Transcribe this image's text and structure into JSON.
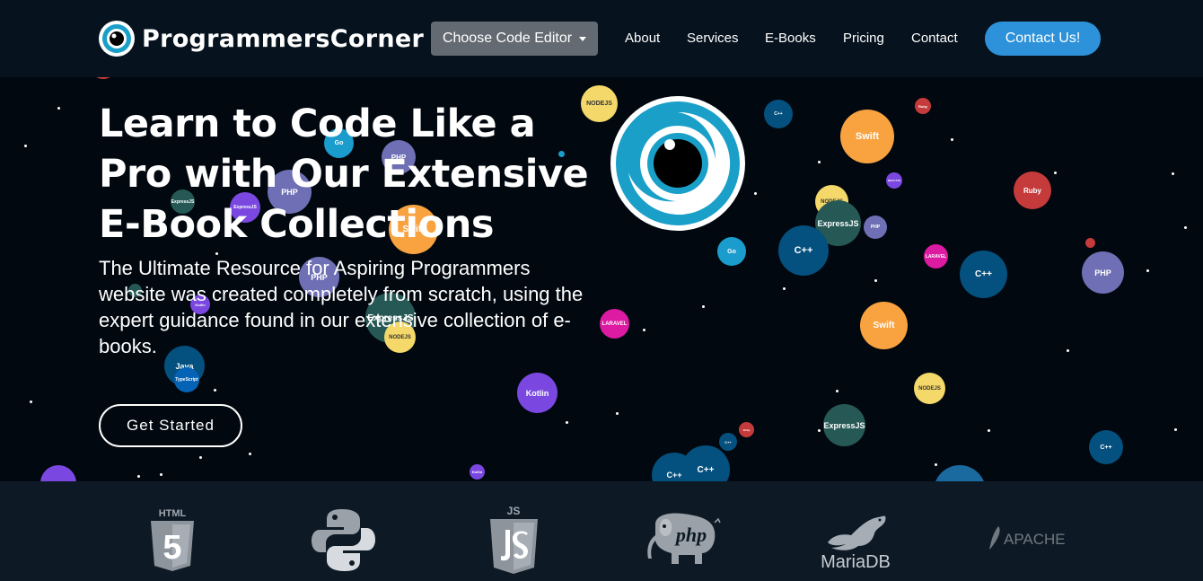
{
  "navbar": {
    "brand": "ProgrammersCorner",
    "editor_dropdown": "Choose Code Editor",
    "links": [
      "About",
      "Services",
      "E-Books",
      "Pricing",
      "Contact"
    ],
    "contact_button": "Contact Us!"
  },
  "hero": {
    "headline": "Learn to Code Like a Pro with Our Extensive E-Book Collections",
    "subtext": "The Ultimate Resource for Aspiring Programmers website was created completely from scratch, using the expert guidance found in our extensive collection of e-books.",
    "cta": "Get Started"
  },
  "bubble_labels": [
    "NODEJS",
    "Go",
    "PHP",
    "ExpressJS",
    "Swift",
    "C++",
    "Ruby",
    "REACTJS",
    "LARAVEL",
    "Java",
    "TypeScript",
    "Kotlin"
  ],
  "tech_logos": {
    "html": "HTML",
    "html_number": "5",
    "js": "JS",
    "php": "php",
    "mariadb": "MariaDB",
    "apache": "APACHE"
  },
  "colors": {
    "navbar_bg": "#06121d",
    "hero_bg": "#02080f",
    "accent": "#2d92d9",
    "dropdown_bg": "#646a72",
    "tech_bar_bg": "#0d1a26"
  }
}
